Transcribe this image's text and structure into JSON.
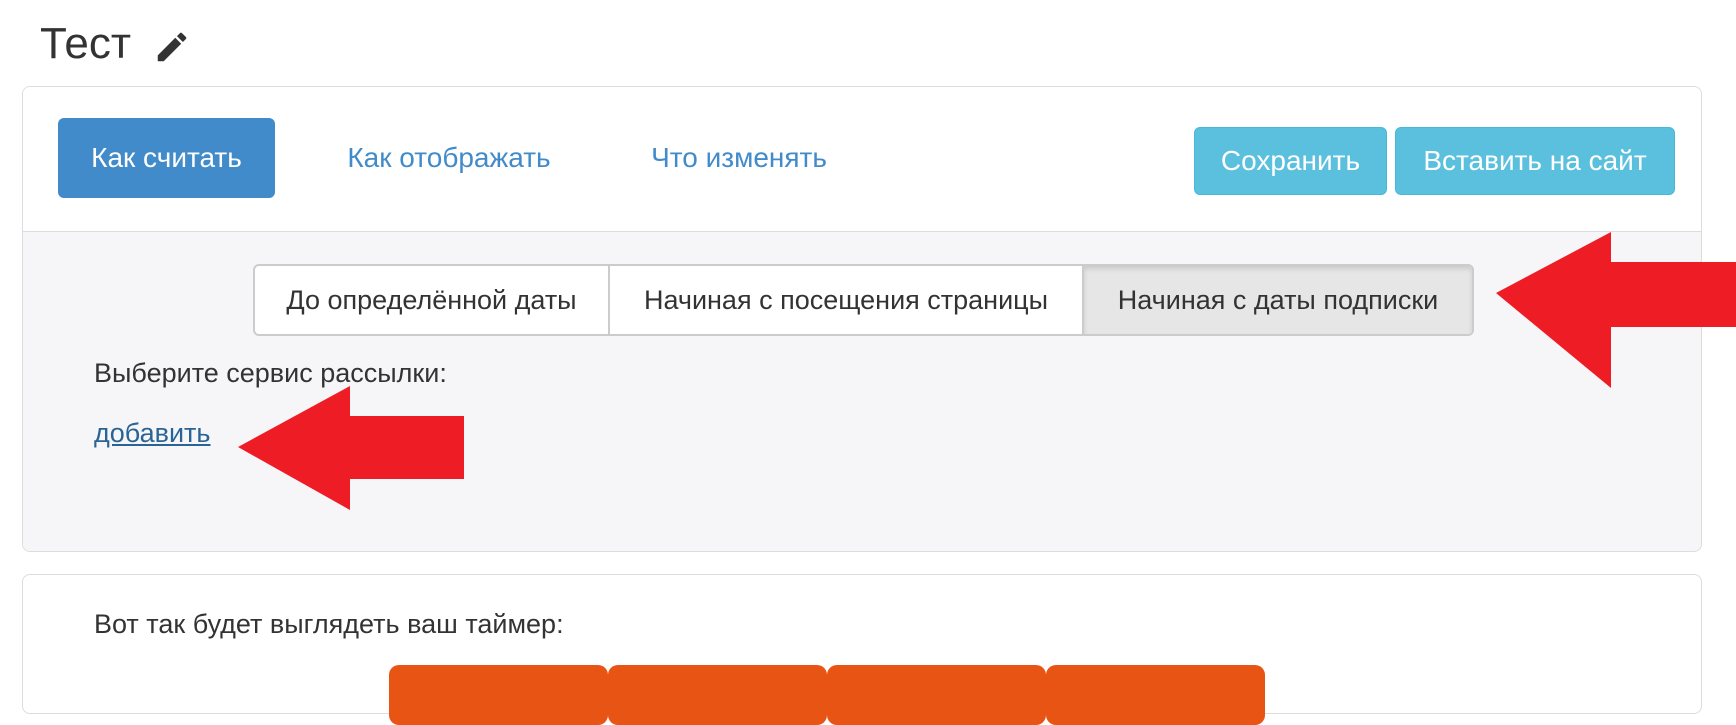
{
  "page": {
    "title": "Тест",
    "edit_icon": "pencil-icon"
  },
  "nav": {
    "tabs": [
      {
        "label": "Как считать",
        "active": true
      },
      {
        "label": "Как отображать",
        "active": false
      },
      {
        "label": "Что изменять",
        "active": false
      }
    ],
    "save_label": "Сохранить",
    "insert_label": "Вставить на сайт"
  },
  "mode": {
    "options": [
      {
        "label": "До определённой даты",
        "selected": false
      },
      {
        "label": "Начиная с посещения страницы",
        "selected": false
      },
      {
        "label": "Начиная с даты подписки",
        "selected": true
      }
    ]
  },
  "mailing": {
    "label": "Выберите сервис рассылки:",
    "add_link": "добавить"
  },
  "preview": {
    "label": "Вот так будет выглядеть ваш таймер:",
    "timer_color": "#e85413"
  },
  "colors": {
    "primary": "#428bca",
    "info": "#5bc0de",
    "annotation_arrow": "#ee1c25"
  }
}
